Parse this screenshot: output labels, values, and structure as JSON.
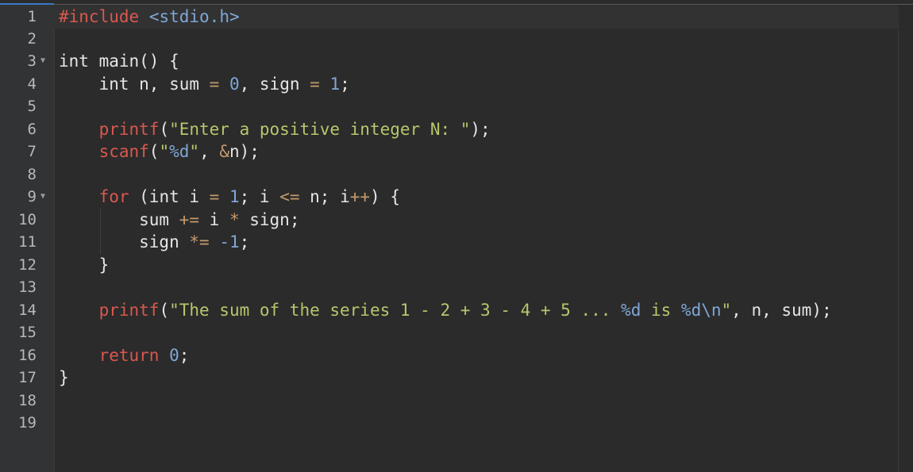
{
  "colors": {
    "background": "#2b2b2b",
    "gutter": "#313335",
    "keyword": "#d9584f",
    "string": "#b5c76c",
    "number": "#7fa7d6",
    "operator": "#c49a6c",
    "text": "#e6e6e6"
  },
  "gutter": {
    "line_numbers": [
      "1",
      "2",
      "3",
      "4",
      "5",
      "6",
      "7",
      "8",
      "9",
      "10",
      "11",
      "12",
      "13",
      "14",
      "15",
      "16",
      "17",
      "18",
      "19"
    ],
    "fold_lines": [
      "3",
      "9"
    ]
  },
  "code": {
    "l1": {
      "t1": "#include",
      "t2": " ",
      "t3": "<stdio.h>"
    },
    "l3": {
      "t1": "int main() {"
    },
    "l4": {
      "t1": "    int n, sum ",
      "t2": "=",
      "t3": " ",
      "t4": "0",
      "t5": ", sign ",
      "t6": "=",
      "t7": " ",
      "t8": "1",
      "t9": ";"
    },
    "l6": {
      "t1": "    ",
      "t2": "printf",
      "t3": "(",
      "t4": "\"Enter a positive integer N: \"",
      "t5": ");"
    },
    "l7": {
      "t1": "    ",
      "t2": "scanf",
      "t3": "(",
      "t4": "\"",
      "t5": "%d",
      "t6": "\"",
      "t7": ", ",
      "t8": "&",
      "t9": "n);"
    },
    "l9": {
      "t1": "    ",
      "t2": "for",
      "t3": " (int i ",
      "t4": "=",
      "t5": " ",
      "t6": "1",
      "t7": "; i ",
      "t8": "<=",
      "t9": " n; i",
      "t10": "++",
      "t11": ") {"
    },
    "l10": {
      "t1": "        sum ",
      "t2": "+=",
      "t3": " i ",
      "t4": "*",
      "t5": " sign;"
    },
    "l11": {
      "t1": "        sign ",
      "t2": "*=",
      "t3": " ",
      "t4": "-1",
      "t5": ";"
    },
    "l12": {
      "t1": "    }"
    },
    "l14": {
      "t1": "    ",
      "t2": "printf",
      "t3": "(",
      "t4": "\"The sum of the series 1 - 2 + 3 - 4 + 5 ... ",
      "t5": "%d",
      "t6": " is ",
      "t7": "%d",
      "t8": "\\n",
      "t9": "\"",
      "t10": ", n, sum);"
    },
    "l16": {
      "t1": "    ",
      "t2": "return",
      "t3": " ",
      "t4": "0",
      "t5": ";"
    },
    "l17": {
      "t1": "}"
    }
  }
}
